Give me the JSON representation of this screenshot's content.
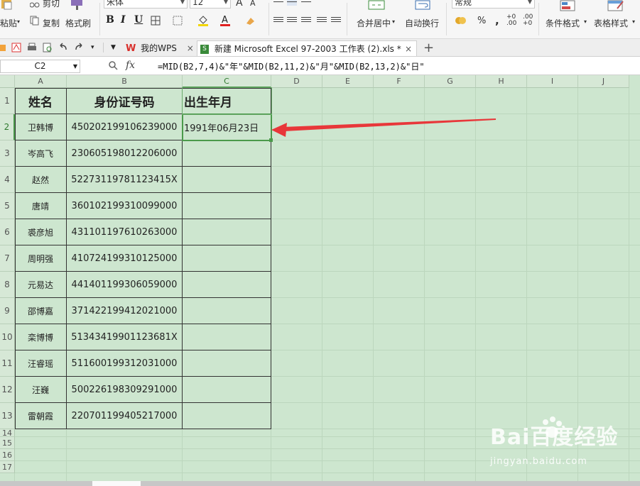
{
  "ribbon": {
    "paste_label": "粘贴",
    "cut_label": "剪切",
    "copy_label": "复制",
    "format_painter_label": "格式刷",
    "font_name": "宋体",
    "font_size": "12",
    "font_grow": "A",
    "font_shrink": "A",
    "bold": "B",
    "italic": "I",
    "underline": "U",
    "merge_center_label": "合并居中",
    "wrap_text_label": "自动换行",
    "number_format": "常规",
    "percent": "%",
    "comma": ",",
    "cond_format_label": "条件格式",
    "table_style_label": "表格样式"
  },
  "tabs": {
    "home_tab": "我的WPS",
    "doc_tab": "新建 Microsoft Excel 97-2003 工作表 (2).xls *",
    "close": "×",
    "add": "+"
  },
  "formula_bar": {
    "name_box": "C2",
    "fx": "fx",
    "formula": "=MID(B2,7,4)&\"年\"&MID(B2,11,2)&\"月\"&MID(B2,13,2)&\"日\""
  },
  "columns": [
    "A",
    "B",
    "C",
    "D",
    "E",
    "F",
    "G",
    "H",
    "I",
    "J"
  ],
  "rows": [
    "1",
    "2",
    "3",
    "4",
    "5",
    "6",
    "7",
    "8",
    "9",
    "10",
    "11",
    "12",
    "13",
    "14",
    "15",
    "16",
    "17"
  ],
  "table": {
    "headers": [
      "姓名",
      "身份证号码",
      "出生年月"
    ],
    "rows": [
      {
        "name": "卫韩博",
        "id": "450202199106239000",
        "birth": "1991年06月23日"
      },
      {
        "name": "岑高飞",
        "id": "230605198012206000",
        "birth": ""
      },
      {
        "name": "赵然",
        "id": "52273119781123415X",
        "birth": ""
      },
      {
        "name": "唐靖",
        "id": "360102199310099000",
        "birth": ""
      },
      {
        "name": "裘彦旭",
        "id": "431101197610263000",
        "birth": ""
      },
      {
        "name": "周明强",
        "id": "410724199310125000",
        "birth": ""
      },
      {
        "name": "元易达",
        "id": "441401199306059000",
        "birth": ""
      },
      {
        "name": "邵博嘉",
        "id": "371422199412021000",
        "birth": ""
      },
      {
        "name": "栾博博",
        "id": "51343419901123681X",
        "birth": ""
      },
      {
        "name": "汪睿瑶",
        "id": "511600199312031000",
        "birth": ""
      },
      {
        "name": "汪巍",
        "id": "500226198309291000",
        "birth": ""
      },
      {
        "name": "雷朝霞",
        "id": "220701199405217000",
        "birth": ""
      }
    ]
  },
  "watermark": {
    "brand": "Bai百度经验",
    "url": "jingyan.baidu.com"
  },
  "colors": {
    "grid_bg": "#cde6cf",
    "selection": "#4b9a4b",
    "arrow": "#e8373a"
  }
}
